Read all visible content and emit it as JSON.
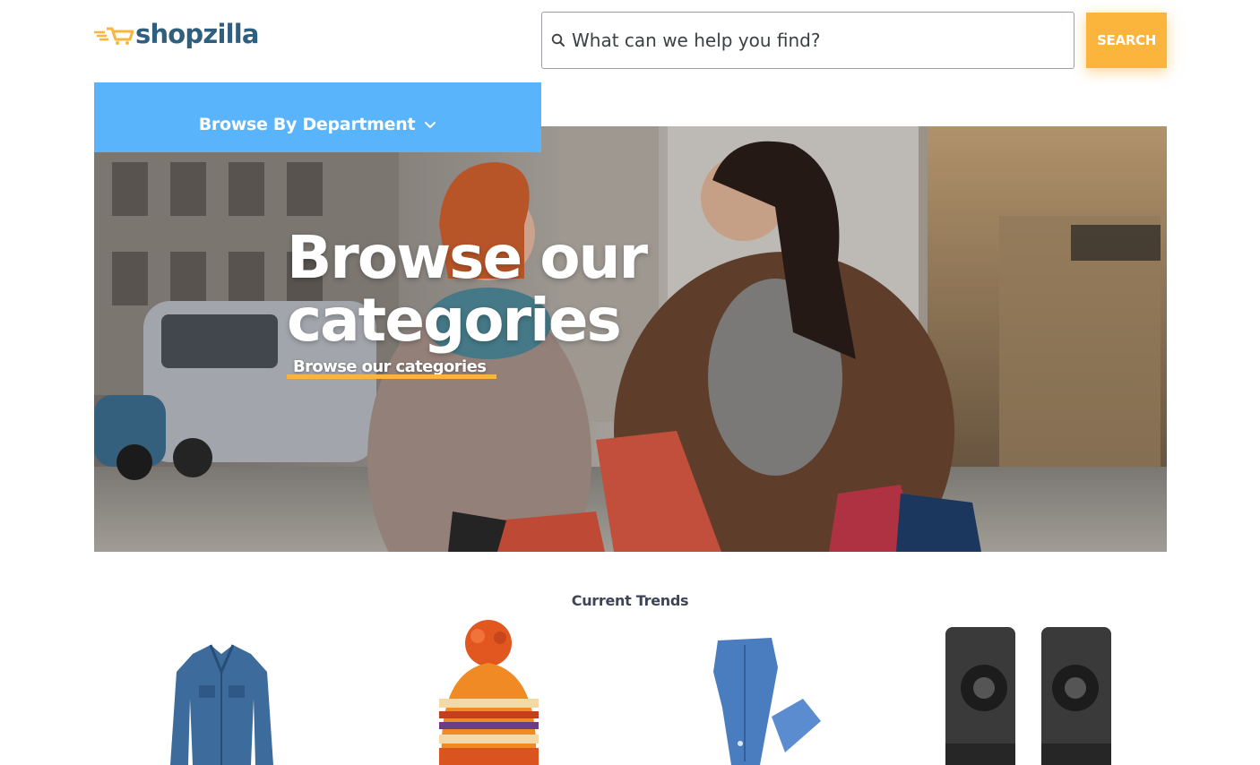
{
  "header": {
    "logo_text": "shopzilla",
    "logo_icon": "cart-logo-icon",
    "search": {
      "placeholder": "What can we help you find?",
      "value": "",
      "icon": "search-icon",
      "button_label": "SEARCH"
    }
  },
  "nav": {
    "browse_department_label": "Browse By Department",
    "dropdown_icon": "chevron-down-icon"
  },
  "hero": {
    "title_line1": "Browse our",
    "title_line2": "categories",
    "link_label": "Browse our categories"
  },
  "trends": {
    "heading": "Current Trends",
    "items": [
      {
        "name": "denim-jacket"
      },
      {
        "name": "pom-pom-beanie"
      },
      {
        "name": "blue-jeans"
      },
      {
        "name": "desktop-speakers"
      }
    ]
  },
  "colors": {
    "brand_blue": "#2e5f7f",
    "accent_yellow": "#fbb43c",
    "dept_blue": "#5ab4fc",
    "text_dark": "#3e4556"
  }
}
